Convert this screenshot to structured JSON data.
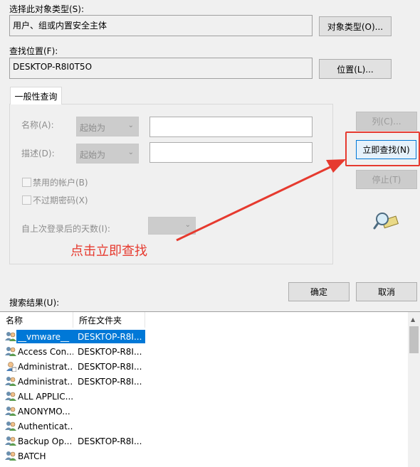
{
  "object_type": {
    "label": "选择此对象类型(S):",
    "value": "用户、组或内置安全主体",
    "button": "对象类型(O)..."
  },
  "location": {
    "label": "查找位置(F):",
    "value": "DESKTOP-R8I0T5O",
    "button": "位置(L)..."
  },
  "tab": {
    "label": "一般性查询"
  },
  "query": {
    "name_label": "名称(A):",
    "name_combo": "起始为",
    "desc_label": "描述(D):",
    "desc_combo": "起始为",
    "disabled_accounts": "禁用的帐户(B)",
    "no_expire": "不过期密码(X)",
    "days_label": "自上次登录后的天数(I):"
  },
  "side_buttons": {
    "columns": "列(C)...",
    "find_now": "立即查找(N)",
    "stop": "停止(T)"
  },
  "dialog_buttons": {
    "ok": "确定",
    "cancel": "取消"
  },
  "annotation": "点击立即查找",
  "results": {
    "label": "搜索结果(U):",
    "columns": [
      "名称",
      "所在文件夹"
    ],
    "rows": [
      {
        "name": "__vmware__",
        "loc": "DESKTOP-R8I...",
        "icon": "group-icon"
      },
      {
        "name": "Access Con...",
        "loc": "DESKTOP-R8I...",
        "icon": "group-icon"
      },
      {
        "name": "Administrat...",
        "loc": "DESKTOP-R8I...",
        "icon": "user-icon"
      },
      {
        "name": "Administrat...",
        "loc": "DESKTOP-R8I...",
        "icon": "group-icon"
      },
      {
        "name": "ALL APPLIC...",
        "loc": "",
        "icon": "group-icon"
      },
      {
        "name": "ANONYMO...",
        "loc": "",
        "icon": "group-icon"
      },
      {
        "name": "Authenticat...",
        "loc": "",
        "icon": "group-icon"
      },
      {
        "name": "Backup Op...",
        "loc": "DESKTOP-R8I...",
        "icon": "group-icon"
      },
      {
        "name": "BATCH",
        "loc": "",
        "icon": "group-icon"
      }
    ]
  }
}
